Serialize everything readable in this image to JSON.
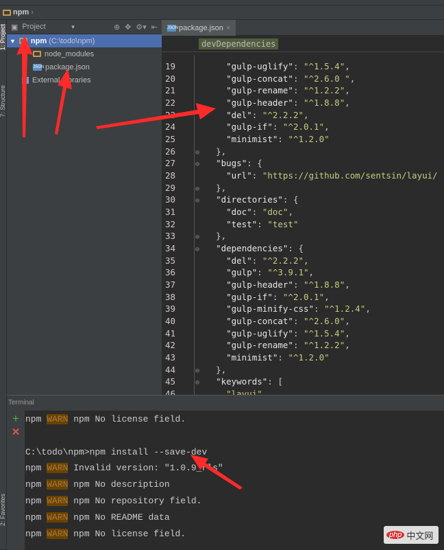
{
  "nav": {
    "project": "npm"
  },
  "stripe": {
    "project_tab": "1: Project",
    "structure_tab": "7: Structure",
    "favorites_tab": "2: Favorites"
  },
  "project_panel": {
    "title": "Project",
    "tree": [
      {
        "label": "npm",
        "path": "(C:\\todo\\npm)",
        "type": "folder",
        "selected": true
      },
      {
        "label": "node_modules",
        "type": "folder"
      },
      {
        "label": "package.json",
        "type": "json"
      },
      {
        "label": "External Libraries",
        "type": "library"
      }
    ]
  },
  "editor": {
    "tab": "package.json",
    "breadcrumb": "devDependencies",
    "lines": [
      {
        "n": 19,
        "indent": 4,
        "k": "\"gulp-uglify\"",
        "s": "\"^1.5.4\"",
        "end": ","
      },
      {
        "n": 20,
        "indent": 4,
        "k": "\"gulp-concat\"",
        "s": "\"^2.6.0 \"",
        "end": ","
      },
      {
        "n": 21,
        "indent": 4,
        "k": "\"gulp-rename\"",
        "s": "\"^1.2.2\"",
        "end": ","
      },
      {
        "n": 22,
        "indent": 4,
        "k": "\"gulp-header\"",
        "s": "\"^1.8.8\"",
        "end": ","
      },
      {
        "n": 23,
        "indent": 4,
        "k": "\"del\"",
        "s": "\"^2.2.2\"",
        "end": ","
      },
      {
        "n": 24,
        "indent": 4,
        "k": "\"gulp-if\"",
        "s": "\"^2.0.1\"",
        "end": ","
      },
      {
        "n": 25,
        "indent": 4,
        "k": "\"minimist\"",
        "s": "\"^1.2.0\"",
        "end": ""
      },
      {
        "n": 26,
        "indent": 2,
        "p": "},",
        "fold": true
      },
      {
        "n": 27,
        "indent": 2,
        "k": "\"bugs\"",
        "p2": ": {",
        "fold": true
      },
      {
        "n": 28,
        "indent": 4,
        "k": "\"url\"",
        "s": "\"https://github.com/sentsin/layui/",
        "end": ""
      },
      {
        "n": 29,
        "indent": 2,
        "p": "},",
        "fold": true
      },
      {
        "n": 30,
        "indent": 2,
        "k": "\"directories\"",
        "p2": ": {",
        "fold": true
      },
      {
        "n": 31,
        "indent": 4,
        "k": "\"doc\"",
        "s": "\"doc\"",
        "end": ","
      },
      {
        "n": 32,
        "indent": 4,
        "k": "\"test\"",
        "s": "\"test\"",
        "end": ""
      },
      {
        "n": 33,
        "indent": 2,
        "p": "},",
        "fold": true
      },
      {
        "n": 34,
        "indent": 2,
        "k": "\"dependencies\"",
        "p2": ": {",
        "fold": true
      },
      {
        "n": 35,
        "indent": 4,
        "k": "\"del\"",
        "s": "\"^2.2.2\"",
        "end": ","
      },
      {
        "n": 36,
        "indent": 4,
        "k": "\"gulp\"",
        "s": "\"^3.9.1\"",
        "end": ","
      },
      {
        "n": 37,
        "indent": 4,
        "k": "\"gulp-header\"",
        "s": "\"^1.8.8\"",
        "end": ","
      },
      {
        "n": 38,
        "indent": 4,
        "k": "\"gulp-if\"",
        "s": "\"^2.0.1\"",
        "end": ","
      },
      {
        "n": 39,
        "indent": 4,
        "k": "\"gulp-minify-css\"",
        "s": "\"^1.2.4\"",
        "end": ","
      },
      {
        "n": 40,
        "indent": 4,
        "k": "\"gulp-concat\"",
        "s": "\"^2.6.0\"",
        "end": ","
      },
      {
        "n": 41,
        "indent": 4,
        "k": "\"gulp-uglify\"",
        "s": "\"^1.5.4\"",
        "end": ","
      },
      {
        "n": 42,
        "indent": 4,
        "k": "\"gulp-rename\"",
        "s": "\"^1.2.2\"",
        "end": ","
      },
      {
        "n": 43,
        "indent": 4,
        "k": "\"minimist\"",
        "s": "\"^1.2.0\"",
        "end": ""
      },
      {
        "n": 44,
        "indent": 2,
        "p": "},",
        "fold": true
      },
      {
        "n": 45,
        "indent": 2,
        "k": "\"keywords\"",
        "p2": ": [",
        "fold": true
      },
      {
        "n": 46,
        "indent": 4,
        "sonly": "\"layui\"",
        "end": ","
      }
    ]
  },
  "terminal": {
    "title": "Terminal",
    "lines": [
      {
        "pre": "npm ",
        "warn": "WARN",
        "post": " npm No license field."
      },
      {
        "pre": ""
      },
      {
        "pre": "C:\\todo\\npm>npm install --save-dev"
      },
      {
        "pre": "npm ",
        "warn": "WARN",
        "post": " Invalid version: \"1.0.9_rls\""
      },
      {
        "pre": "npm ",
        "warn": "WARN",
        "post": " npm No description"
      },
      {
        "pre": "npm ",
        "warn": "WARN",
        "post": " npm No repository field."
      },
      {
        "pre": "npm ",
        "warn": "WARN",
        "post": " npm No README data"
      },
      {
        "pre": "npm ",
        "warn": "WARN",
        "post": " npm No license field."
      }
    ]
  },
  "watermark": {
    "text": "php中文网"
  },
  "colors": {
    "selection": "#4b6eaf",
    "warn_bg": "#6b4200",
    "arrow": "#ff2a2a",
    "string": "#c9c980"
  }
}
